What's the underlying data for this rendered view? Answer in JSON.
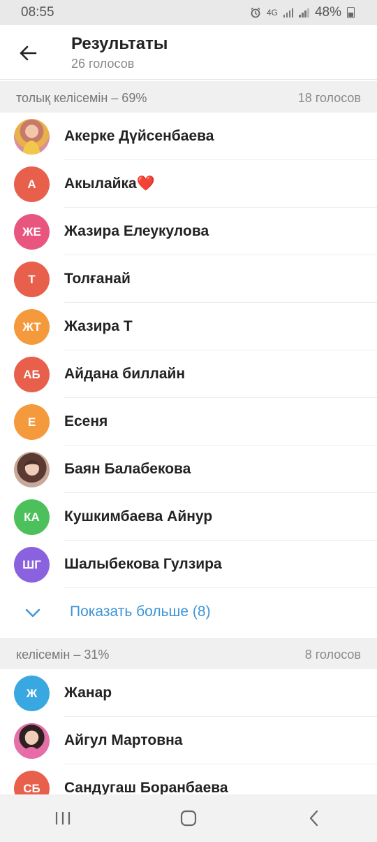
{
  "status_bar": {
    "time": "08:55",
    "network": "4G",
    "battery": "48%"
  },
  "header": {
    "title": "Результаты",
    "subtitle": "26 голосов"
  },
  "sections": [
    {
      "option": "толық келісемін – 69%",
      "votes": "18 голосов",
      "voters": [
        {
          "name": "Акерке Дүйсенбаева",
          "initials": "",
          "color": "#e8a0a8",
          "photo": true
        },
        {
          "name": "Акылайка❤️",
          "initials": "А",
          "color": "#e8604c"
        },
        {
          "name": "Жазира Елеукулова",
          "initials": "ЖЕ",
          "color": "#e85680"
        },
        {
          "name": "Толғанай",
          "initials": "Т",
          "color": "#e8604c"
        },
        {
          "name": "Жазира Т",
          "initials": "ЖТ",
          "color": "#f59a3c"
        },
        {
          "name": "Айдана биллайн",
          "initials": "АБ",
          "color": "#e8604c"
        },
        {
          "name": "Есеня",
          "initials": "Е",
          "color": "#f59a3c"
        },
        {
          "name": "Баян Балабекова",
          "initials": "",
          "color": "#b09080",
          "photo": true
        },
        {
          "name": "Кушкимбаева Айнур",
          "initials": "КА",
          "color": "#4cc05a"
        },
        {
          "name": "Шалыбекова Гулзира",
          "initials": "ШГ",
          "color": "#8a62e0"
        }
      ],
      "show_more": "Показать больше (8)"
    },
    {
      "option": "келісемін – 31%",
      "votes": "8 голосов",
      "voters": [
        {
          "name": "Жанар",
          "initials": "Ж",
          "color": "#3aa8e0"
        },
        {
          "name": "Айгул Мартовна",
          "initials": "",
          "color": "#d080a0",
          "photo": true
        },
        {
          "name": "Сандугаш Боранбаева",
          "initials": "СБ",
          "color": "#e8604c"
        }
      ]
    }
  ],
  "icons": [
    "back-arrow-icon",
    "chevron-down-icon",
    "recent-apps-icon",
    "home-icon",
    "back-icon",
    "alarm-icon",
    "signal-icon",
    "battery-icon"
  ]
}
